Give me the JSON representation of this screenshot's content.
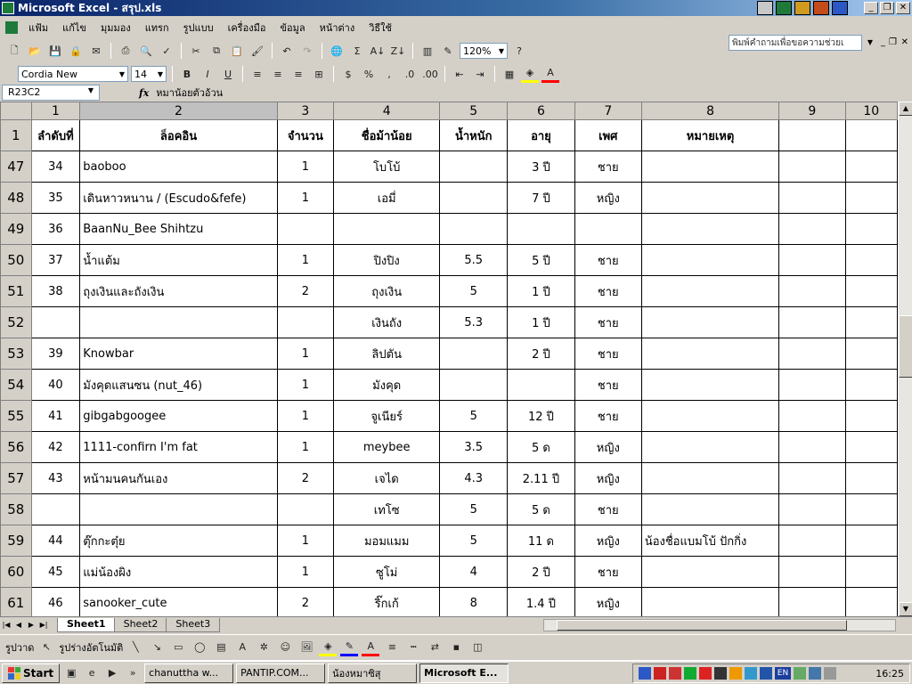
{
  "window": {
    "title": "Microsoft Excel - สรุป.xls"
  },
  "menu": {
    "items": [
      "แฟ้ม",
      "แก้ไข",
      "มุมมอง",
      "แทรก",
      "รูปแบบ",
      "เครื่องมือ",
      "ข้อมูล",
      "หน้าต่าง",
      "วิธีใช้"
    ],
    "ask_placeholder": "พิมพ์คำถามเพื่อขอความช่วยเ"
  },
  "toolbar": {
    "zoom": "120%",
    "font": "Cordia New",
    "size": "14"
  },
  "formula": {
    "namebox": "R23C2",
    "fx": "fx",
    "value": "หมาน้อยตัวอ้วน"
  },
  "grid": {
    "columns": [
      "1",
      "2",
      "3",
      "4",
      "5",
      "6",
      "7",
      "8",
      "9",
      "10"
    ],
    "header_row": {
      "num": "1",
      "cells": [
        "ลำดับที่",
        "ล็อคอิน",
        "จำนวน",
        "ชื่อม้าน้อย",
        "น้ำหนัก",
        "อายุ",
        "เพศ",
        "หมายเหตุ",
        "",
        ""
      ]
    },
    "rows": [
      {
        "num": "47",
        "cells": [
          "34",
          "baoboo",
          "1",
          "โบโบ้",
          "",
          "3 ปี",
          "ชาย",
          "",
          "",
          ""
        ]
      },
      {
        "num": "48",
        "cells": [
          "35",
          "เดินหาวหนาน / (Escudo&fefe)",
          "1",
          "เอมี่",
          "",
          "7 ปี",
          "หญิง",
          "",
          "",
          ""
        ]
      },
      {
        "num": "49",
        "cells": [
          "36",
          "BaanNu_Bee Shihtzu",
          "",
          "",
          "",
          "",
          "",
          "",
          "",
          ""
        ]
      },
      {
        "num": "50",
        "cells": [
          "37",
          "น้ำแต้ม",
          "1",
          "ปิงปิง",
          "5.5",
          "5 ปี",
          "ชาย",
          "",
          "",
          ""
        ]
      },
      {
        "num": "51",
        "cells": [
          "38",
          "ถุงเงินและถังเงิน",
          "2",
          "ถุงเงิน",
          "5",
          "1 ปี",
          "ชาย",
          "",
          "",
          ""
        ]
      },
      {
        "num": "52",
        "cells": [
          "",
          "",
          "",
          "เงินถัง",
          "5.3",
          "1 ปี",
          "ชาย",
          "",
          "",
          ""
        ]
      },
      {
        "num": "53",
        "cells": [
          "39",
          "Knowbar",
          "1",
          "ลิปตัน",
          "",
          "2 ปี",
          "ชาย",
          "",
          "",
          ""
        ]
      },
      {
        "num": "54",
        "cells": [
          "40",
          "มังคุดแสนซน (nut_46)",
          "1",
          "มังคุด",
          "",
          "",
          "ชาย",
          "",
          "",
          ""
        ]
      },
      {
        "num": "55",
        "cells": [
          "41",
          "gibgabgoogee",
          "1",
          "จูเนียร์",
          "5",
          "12 ปี",
          "ชาย",
          "",
          "",
          ""
        ]
      },
      {
        "num": "56",
        "cells": [
          "42",
          "1111-confirn I'm fat",
          "1",
          "meybee",
          "3.5",
          "5 ด",
          "หญิง",
          "",
          "",
          ""
        ]
      },
      {
        "num": "57",
        "cells": [
          "43",
          "หน้ามนคนกันเอง",
          "2",
          "เจได",
          "4.3",
          "2.11 ปี",
          "หญิง",
          "",
          "",
          ""
        ]
      },
      {
        "num": "58",
        "cells": [
          "",
          "",
          "",
          "เทโซ",
          "5",
          "5 ด",
          "ชาย",
          "",
          "",
          ""
        ]
      },
      {
        "num": "59",
        "cells": [
          "44",
          "ตุ๊กกะตุ๋ย",
          "1",
          "มอมแมม",
          "5",
          "11 ด",
          "หญิง",
          "น้องชื่อแบมโบ้ ปักกิ่ง",
          "",
          ""
        ]
      },
      {
        "num": "60",
        "cells": [
          "45",
          "แม่น้องผิง",
          "1",
          "ซูโม่",
          "4",
          "2 ปี",
          "ชาย",
          "",
          "",
          ""
        ]
      },
      {
        "num": "61",
        "cells": [
          "46",
          "sanooker_cute",
          "2",
          "ริ๊กเก้",
          "8",
          "1.4 ปี",
          "หญิง",
          "",
          "",
          ""
        ]
      }
    ]
  },
  "sheets": [
    "Sheet1",
    "Sheet2",
    "Sheet3"
  ],
  "drawbar": {
    "draw": "รูปวาด",
    "autoshapes": "รูปร่างอัตโนมัติ"
  },
  "taskbar": {
    "start": "Start",
    "buttons": [
      "chanuttha w...",
      "PANTIP.COM...",
      "น้องหมาซิสุ",
      "Microsoft E..."
    ],
    "clock": "16:25",
    "lang": "EN"
  }
}
